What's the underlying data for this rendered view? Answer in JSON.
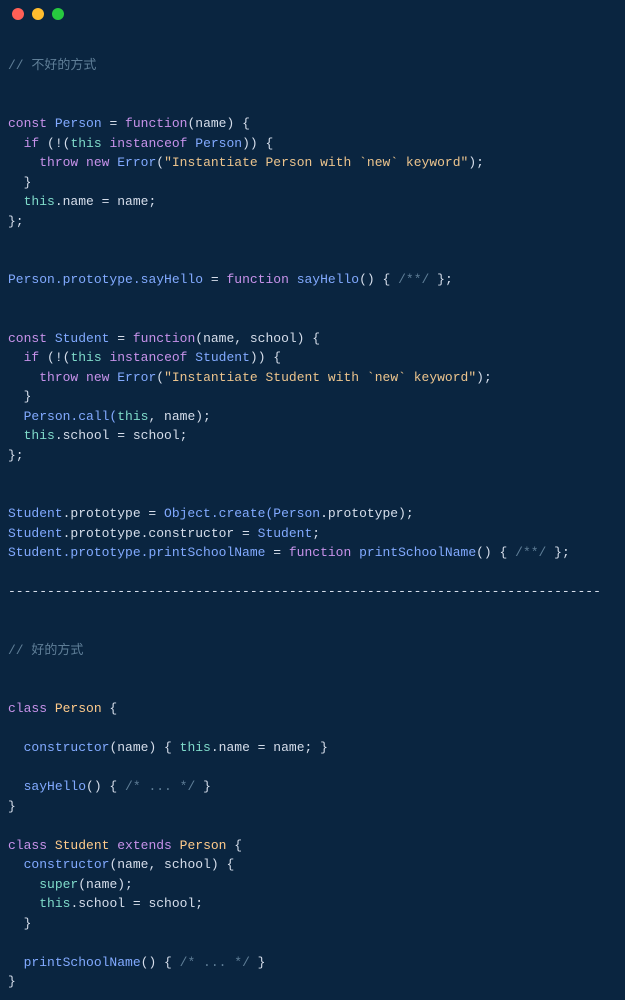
{
  "code": {
    "comment_bad": "// 不好的方式",
    "comment_good": "// 好的方式",
    "separator": "----------------------------------------------------------------------------",
    "bad_section": {
      "person_decl": {
        "const": "const",
        "name": "Person",
        "eq": " = ",
        "function": "function",
        "params": "(name) {",
        "if": "if",
        "cond_open": " (!(",
        "this": "this",
        "instanceof": " instanceof ",
        "type": "Person",
        "cond_close": ")) {",
        "throw": "throw",
        "new": " new ",
        "error": "Error",
        "paren_open": "(",
        "str": "\"Instantiate Person with `new` keyword\"",
        "paren_close": ");",
        "brace1": "}",
        "this2": "this",
        "dot_name": ".name = name;",
        "brace2": "};"
      },
      "person_proto": {
        "obj": "Person",
        "proto": ".prototype.",
        "method": "sayHello",
        "eq": " = ",
        "function": "function",
        "name": " sayHello",
        "body": "() { ",
        "comment": "/**/",
        "close": " };"
      },
      "student_decl": {
        "const": "const",
        "name": "Student",
        "eq": " = ",
        "function": "function",
        "params": "(name, school) {",
        "if": "if",
        "cond_open": " (!(",
        "this": "this",
        "instanceof": " instanceof ",
        "type": "Student",
        "cond_close": ")) {",
        "throw": "throw",
        "new": " new ",
        "error": "Error",
        "paren_open": "(",
        "str": "\"Instantiate Student with `new` keyword\"",
        "paren_close": ");",
        "brace1": "}",
        "person_call": "Person",
        "call": ".call(",
        "this2": "this",
        "args": ", name);",
        "this3": "this",
        "dot_school": ".school = school;",
        "brace2": "};"
      },
      "student_proto1": {
        "obj": "Student",
        "proto": ".prototype = ",
        "object": "Object",
        "create": ".create(",
        "person": "Person",
        "rest": ".prototype);"
      },
      "student_proto2": {
        "obj": "Student",
        "proto": ".prototype.constructor = ",
        "val": "Student",
        "semi": ";"
      },
      "student_proto3": {
        "obj": "Student",
        "proto": ".prototype.",
        "method": "printSchoolName",
        "eq": " = ",
        "function": "function",
        "name": " printSchoolName",
        "body": "() { ",
        "comment": "/**/",
        "close": " };"
      }
    },
    "good_section": {
      "person_class": {
        "class": "class",
        "name": " Person",
        "open": " {",
        "constructor": "constructor",
        "params": "(name) { ",
        "this": "this",
        "body": ".name = name; }",
        "method": "sayHello",
        "method_body": "() { ",
        "comment": "/* ... */",
        "method_close": " }",
        "close": "}"
      },
      "student_class": {
        "class": "class",
        "name": " Student",
        "extends": " extends",
        "parent": " Person",
        "open": " {",
        "constructor": "constructor",
        "params": "(name, school) {",
        "super": "super",
        "super_args": "(name);",
        "this": "this",
        "body": ".school = school;",
        "brace": "}",
        "method": "printSchoolName",
        "method_body": "() { ",
        "comment": "/* ... */",
        "method_close": " }",
        "close": "}"
      }
    }
  }
}
